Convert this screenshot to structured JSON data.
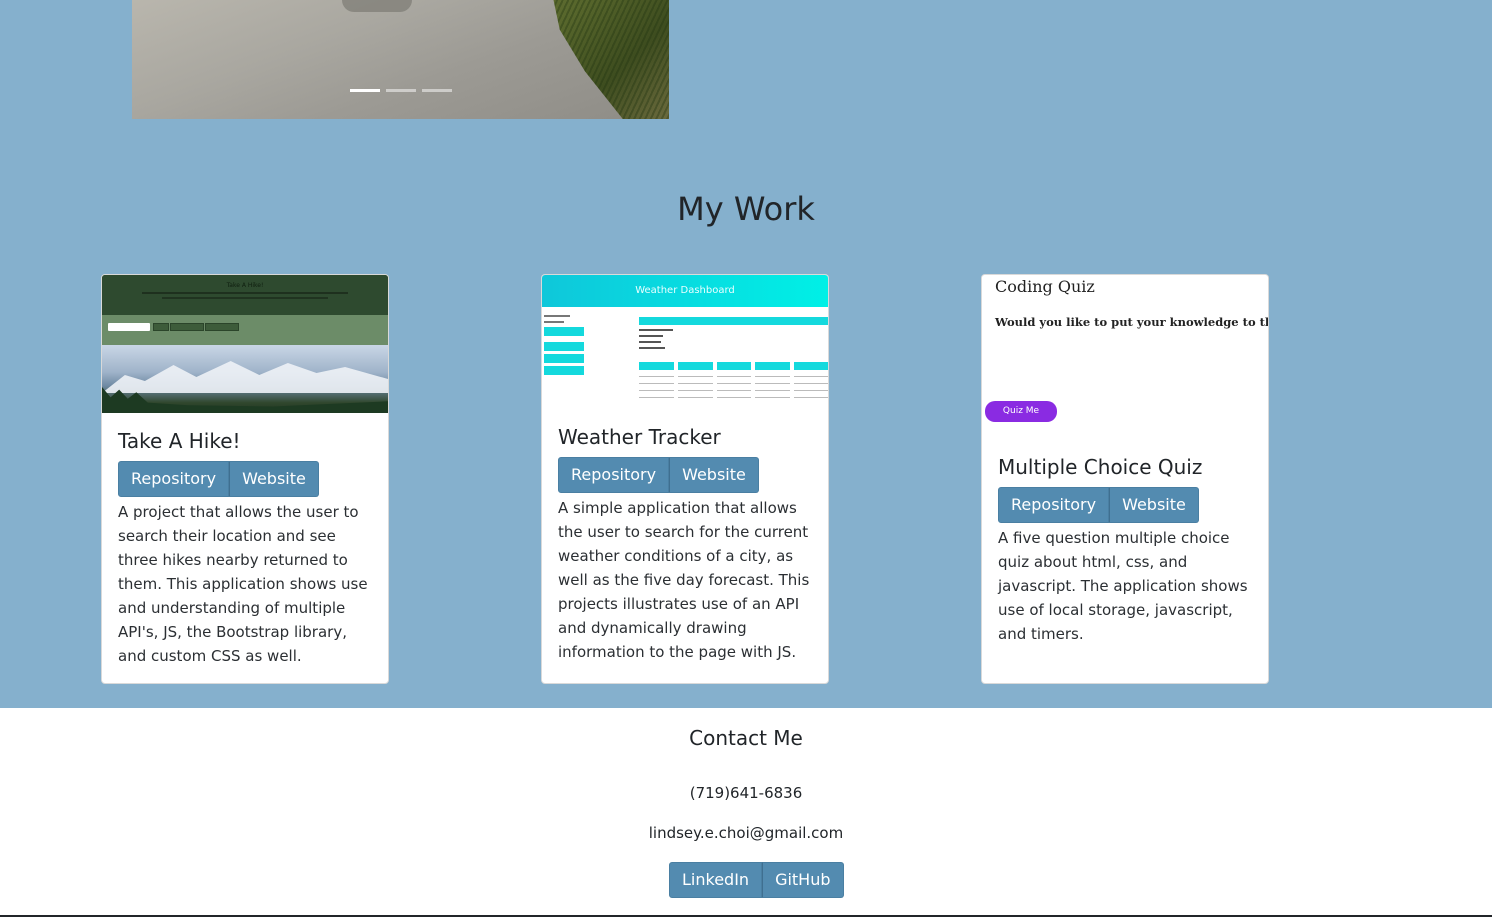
{
  "carousel": {
    "indicators": [
      true,
      false,
      false
    ]
  },
  "work": {
    "title": "My Work",
    "projects": [
      {
        "title": "Take A Hike!",
        "repo_label": "Repository",
        "site_label": "Website",
        "description": "A project that allows the user to search their location and see three hikes nearby returned to them. This application shows use and understanding of multiple API's, JS, the Bootstrap library, and custom CSS as well.",
        "image_title": "Take A Hike!"
      },
      {
        "title": "Weather Tracker",
        "repo_label": "Repository",
        "site_label": "Website",
        "description": "A simple application that allows the user to search for the current weather conditions of a city, as well as the five day forecast. This projects illustrates use of an API and dynamically drawing information to the page with JS.",
        "image_title": "Weather Dashboard"
      },
      {
        "title": "Multiple Choice Quiz",
        "repo_label": "Repository",
        "site_label": "Website",
        "description": "A five question multiple choice quiz about html, css, and javascript. The application shows use of local storage, javascript, and timers.",
        "image_title": "Coding Quiz",
        "image_question": "Would you like to put your knowledge to the test?",
        "image_button": "Quiz Me"
      }
    ]
  },
  "contact": {
    "title": "Contact Me",
    "phone": "(719)641-6836",
    "email": "lindsey.e.choi@gmail.com",
    "linkedin_label": "LinkedIn",
    "github_label": "GitHub"
  },
  "colors": {
    "section_bg": "#85b0cd",
    "button_bg": "#538bb0",
    "quiz_button": "#8a2be2",
    "weather_accent": "#14d9dd"
  }
}
